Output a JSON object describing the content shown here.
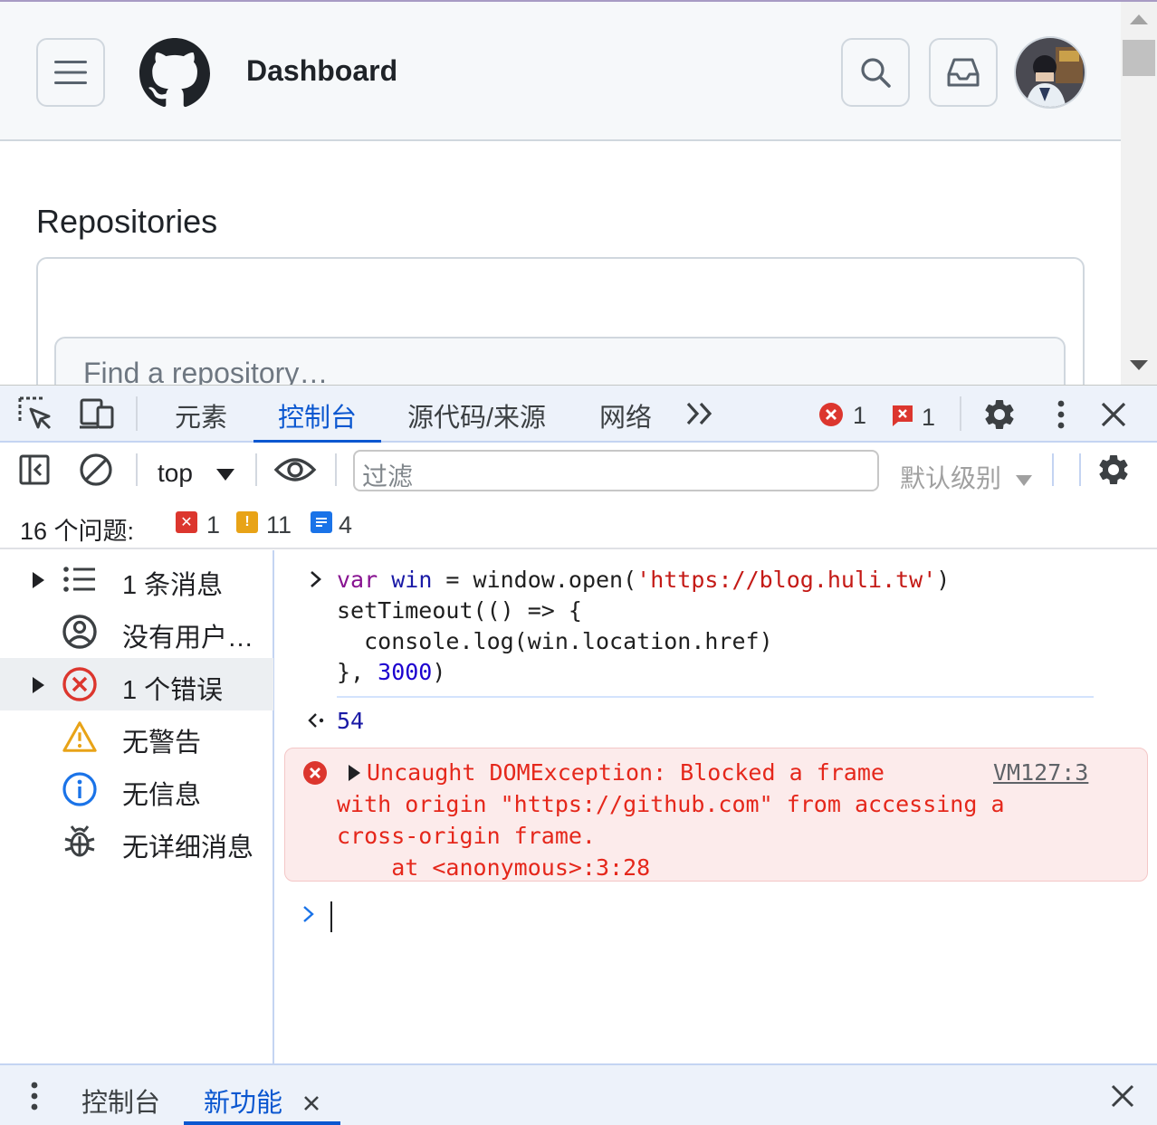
{
  "page": {
    "header_title": "Dashboard",
    "section_title": "Repositories",
    "repo_search_placeholder": "Find a repository…"
  },
  "devtools": {
    "tabs": [
      "元素",
      "控制台",
      "源代码/来源",
      "网络"
    ],
    "active_tab": "控制台",
    "more_tabs_icon": "chevrons-right-icon",
    "error_count": "1",
    "issue_error_count": "1",
    "toolbar": {
      "context": "top",
      "filter_placeholder": "过滤",
      "level": "默认级别"
    },
    "issues": {
      "label": "16 个问题:",
      "errors": "1",
      "warnings": "11",
      "info": "4"
    },
    "sidebar": [
      {
        "label": "1 条消息",
        "icon": "list-icon",
        "expandable": true
      },
      {
        "label": "没有用户消息",
        "icon": "user-circle-icon",
        "expandable": false
      },
      {
        "label": "1 个错误",
        "icon": "error-circle-icon",
        "expandable": true,
        "selected": true
      },
      {
        "label": "无警告",
        "icon": "warning-triangle-icon",
        "expandable": false
      },
      {
        "label": "无信息",
        "icon": "info-circle-icon",
        "expandable": false
      },
      {
        "label": "无详细消息",
        "icon": "bug-icon",
        "expandable": false
      }
    ],
    "console": {
      "result_value": "54",
      "error_lines": [
        "Uncaught DOMException: Blocked a frame",
        "with origin \"https://github.com\" from accessing a",
        "cross-origin frame.",
        "    at <anonymous>:3:28"
      ],
      "error_source": "VM127:3"
    },
    "drawer": {
      "tabs": [
        "控制台",
        "新功能"
      ],
      "active": "新功能"
    }
  },
  "colors": {
    "accent": "#0b57d0",
    "error": "#e5271b",
    "warning": "#e8a317",
    "info": "#1a73e8"
  }
}
